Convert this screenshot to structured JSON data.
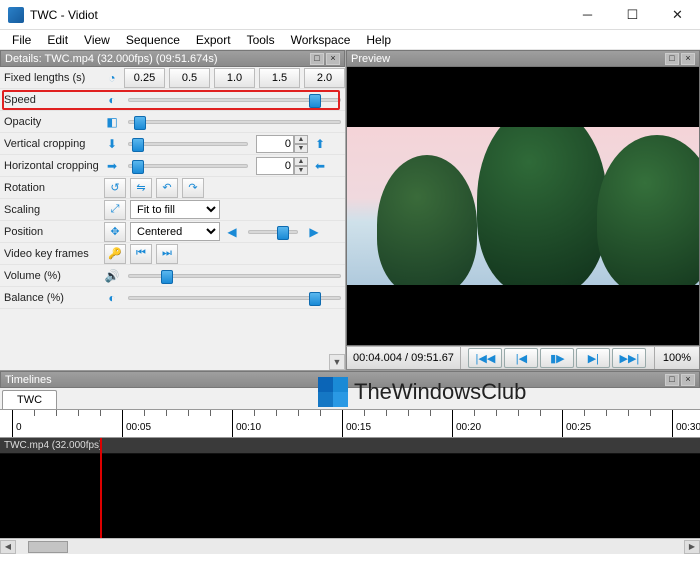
{
  "window": {
    "title": "TWC - Vidiot"
  },
  "menu": [
    "File",
    "Edit",
    "View",
    "Sequence",
    "Export",
    "Tools",
    "Workspace",
    "Help"
  ],
  "details": {
    "title": "Details: TWC.mp4 (32.000fps) (09:51.674s)",
    "rows": {
      "fixed_label": "Fixed lengths (s)",
      "fixed_values": [
        "0.25",
        "0.5",
        "1.0",
        "1.5",
        "2.0"
      ],
      "speed": "Speed",
      "opacity": "Opacity",
      "vcrop": "Vertical cropping",
      "hcrop": "Horizontal cropping",
      "rotation": "Rotation",
      "scaling": "Scaling",
      "scaling_value": "Fit to fill",
      "position": "Position",
      "position_value": "Centered",
      "vkey": "Video key frames",
      "volume": "Volume (%)",
      "balance": "Balance (%)"
    },
    "crop_value": "0"
  },
  "preview": {
    "title": "Preview",
    "time": "00:04.004 / 09:51.67",
    "zoom": "100%"
  },
  "timelines": {
    "title": "Timelines",
    "tab": "TWC",
    "ruler": [
      "0",
      "00:05",
      "00:10",
      "00:15",
      "00:20",
      "00:25",
      "00:30"
    ],
    "clip": "TWC.mp4 (32.000fps)"
  },
  "watermark": "TheWindowsClub"
}
